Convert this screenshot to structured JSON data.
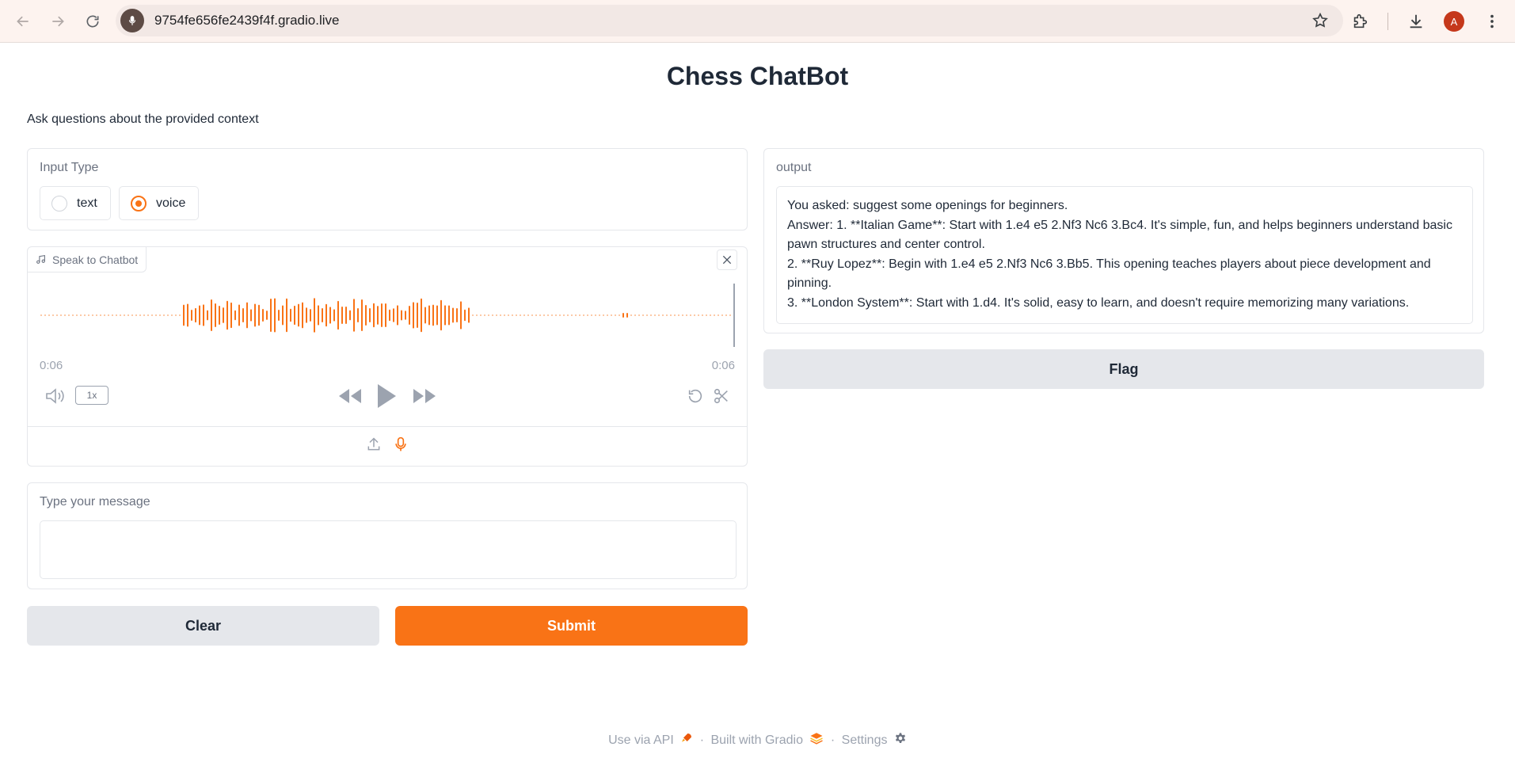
{
  "browser": {
    "url": "9754fe656fe2439f4f.gradio.live",
    "avatar_letter": "A"
  },
  "page": {
    "title": "Chess ChatBot",
    "description": "Ask questions about the provided context"
  },
  "input_type": {
    "label": "Input Type",
    "options": [
      "text",
      "voice"
    ],
    "selected": "voice"
  },
  "audio": {
    "tag_label": "Speak to Chatbot",
    "current_time": "0:06",
    "duration": "0:06",
    "speed": "1x"
  },
  "message": {
    "label": "Type your message",
    "value": ""
  },
  "buttons": {
    "clear": "Clear",
    "submit": "Submit",
    "flag": "Flag"
  },
  "output": {
    "label": "output",
    "lines": [
      "You asked: suggest some openings for beginners.",
      "Answer: 1. **Italian Game**: Start with 1.e4 e5 2.Nf3 Nc6 3.Bc4. It's simple, fun, and helps beginners understand basic pawn structures and center control.",
      "2. **Ruy Lopez**: Begin with 1.e4 e5 2.Nf3 Nc6 3.Bb5. This opening teaches players about piece development and pinning.",
      "3. **London System**: Start with 1.d4. It's solid, easy to learn, and doesn't require memorizing many variations."
    ]
  },
  "footer": {
    "api": "Use via API",
    "built": "Built with Gradio",
    "settings": "Settings",
    "dot": "·"
  },
  "colors": {
    "accent": "#f97316",
    "secondary_button": "#e5e7eb"
  }
}
